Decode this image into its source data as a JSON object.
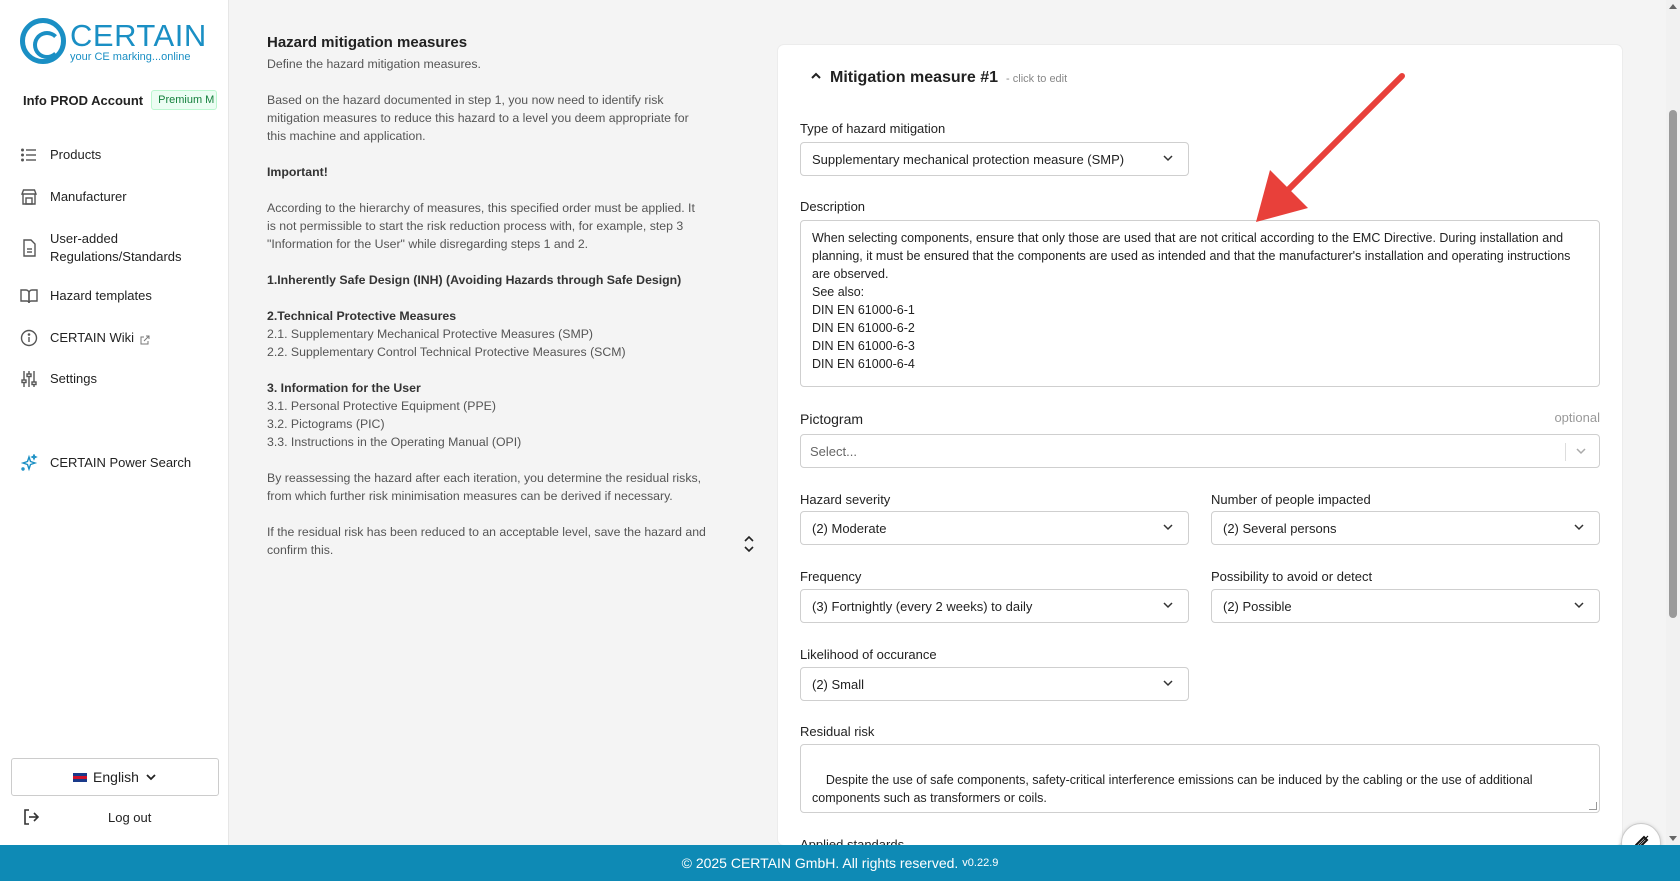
{
  "brand": {
    "name": "CERTAIN",
    "tagline": "your CE marking...online",
    "accent": "#1a8fc4"
  },
  "account": {
    "name": "Info PROD Account",
    "plan": "Premium M"
  },
  "nav": [
    {
      "label": "Products",
      "icon": "list-icon"
    },
    {
      "label": "Manufacturer",
      "icon": "store-icon"
    },
    {
      "label": "User-added Regulations/Standards",
      "icon": "document-icon"
    },
    {
      "label": "Hazard templates",
      "icon": "book-icon"
    },
    {
      "label": "CERTAIN Wiki",
      "icon": "info-icon"
    },
    {
      "label": "Settings",
      "icon": "sliders-icon"
    },
    {
      "label": "CERTAIN Power Search",
      "icon": "sparkle-icon"
    }
  ],
  "language": {
    "label": "English"
  },
  "logout": {
    "label": "Log out"
  },
  "info": {
    "title": "Hazard mitigation measures",
    "subtitle": "Define the hazard mitigation measures.",
    "intro": "Based on the hazard documented in step 1, you now need to identify risk mitigation measures to reduce this hazard to a level you deem appropriate for this machine and application.",
    "important": "Important!",
    "hierarchy": "According to the hierarchy of measures, this specified order must be applied. It is not permissible to start the risk reduction process with, for example, step 3 \"Information for the User\" while disregarding steps 1 and 2.",
    "step1": "1.Inherently Safe Design (INH) (Avoiding Hazards through Safe Design)",
    "step2": "2.Technical Protective Measures",
    "step2_1": "2.1. Supplementary Mechanical Protective Measures (SMP)",
    "step2_2": "2.2. Supplementary Control Technical Protective Measures (SCM)",
    "step3": "3. Information for the User",
    "step3_1": "3.1. Personal Protective Equipment (PPE)",
    "step3_2": "3.2. Pictograms (PIC)",
    "step3_3": "3.3. Instructions in the Operating Manual (OPI)",
    "reassess": "By reassessing the hazard after each iteration, you determine the residual risks, from which further risk minimisation measures can be derived if necessary.",
    "save": "If the residual risk has been reduced to an acceptable level, save the hazard and confirm this."
  },
  "measure": {
    "title": "Mitigation measure #1",
    "hint": "- click to edit",
    "type_label": "Type of hazard mitigation",
    "type_value": "Supplementary mechanical protection measure (SMP)",
    "description_label": "Description",
    "description_value": "When selecting components, ensure that only those are used that are not critical according to the EMC Directive. During installation and planning, it must be ensured that the components are used as intended and that the manufacturer's installation and operating instructions are observed.\nSee also:\nDIN EN 61000-6-1\nDIN EN 61000-6-2\nDIN EN 61000-6-3\nDIN EN 61000-6-4",
    "pictogram_label": "Pictogram",
    "pictogram_optional": "optional",
    "pictogram_placeholder": "Select...",
    "severity_label": "Hazard severity",
    "severity_value": "(2) Moderate",
    "people_label": "Number of people impacted",
    "people_value": "(2) Several persons",
    "frequency_label": "Frequency",
    "frequency_value": "(3) Fortnightly (every 2 weeks) to daily",
    "avoid_label": "Possibility to avoid or detect",
    "avoid_value": "(2) Possible",
    "likelihood_label": "Likelihood of occurance",
    "likelihood_value": "(2) Small",
    "residual_label": "Residual risk",
    "residual_value": "Despite the use of safe components, safety-critical interference emissions can be induced by the cabling or the use of additional components such as transformers or coils.",
    "standards_label": "Applied standards"
  },
  "footer": {
    "text": "© 2025 CERTAIN GmbH. All rights reserved.",
    "version": "v0.22.9",
    "color": "#0e8ab5"
  },
  "annotation": {
    "arrow_color": "#e8403a"
  }
}
